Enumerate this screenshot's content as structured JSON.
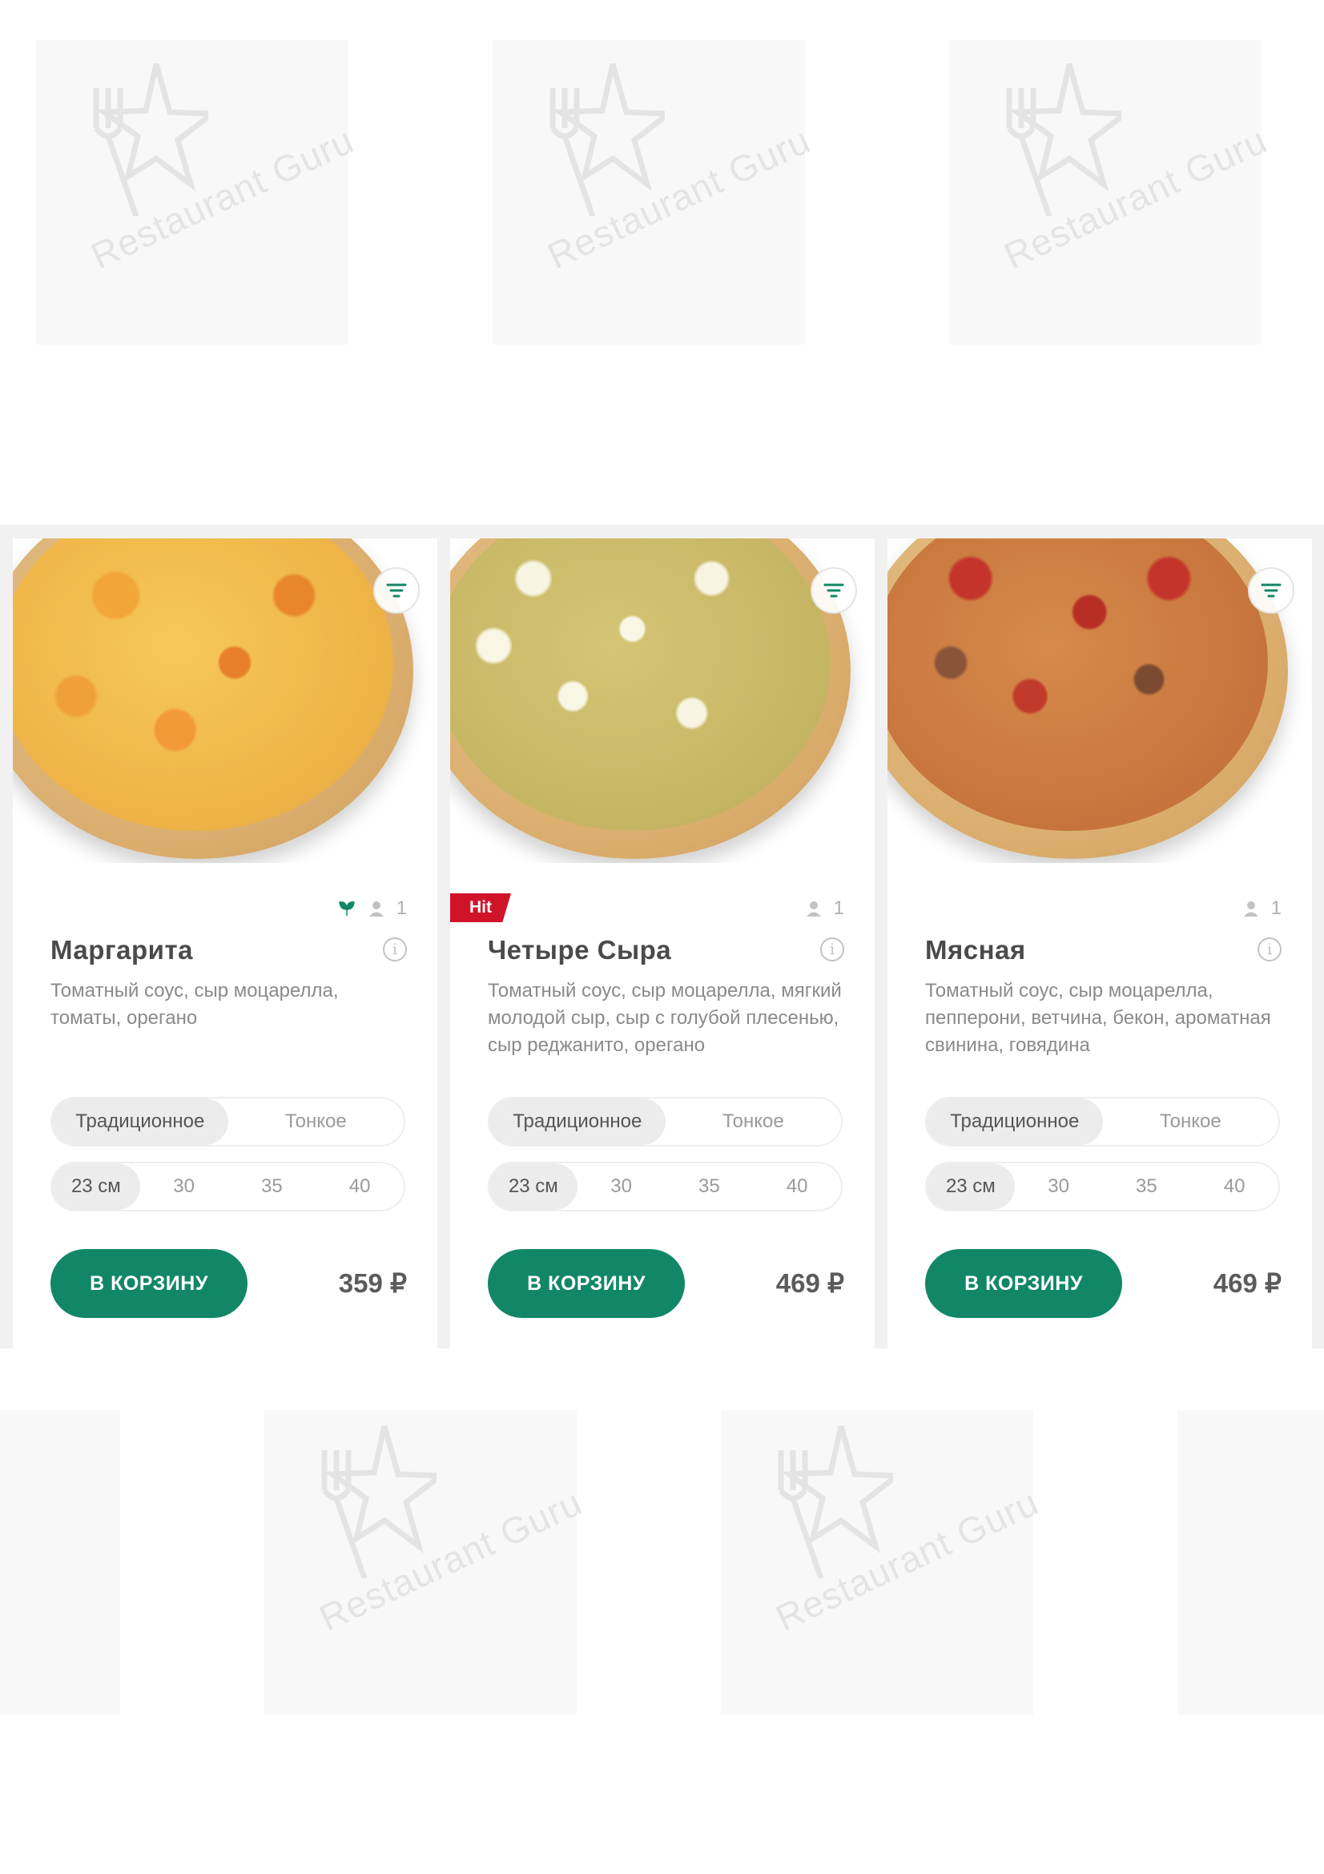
{
  "watermark": {
    "text": "Restaurant Guru",
    "color": "#e4e4e4"
  },
  "colors": {
    "accent": "#128767",
    "hit_badge": "#d1132a",
    "strip_bg": "#f1f1f1"
  },
  "products": [
    {
      "name": "Маргарита",
      "description": "Томатный соус, сыр моцарелла, томаты, орегано",
      "badge": "",
      "vegetarian": true,
      "persons": "1",
      "dough_options": [
        "Традиционное",
        "Тонкое"
      ],
      "dough_selected": "Традиционное",
      "sizes": [
        "23 см",
        "30",
        "35",
        "40"
      ],
      "size_selected": "23 см",
      "button": "В КОРЗИНУ",
      "price": "359 ₽",
      "icon_filter": "filter-icon",
      "icon_info": "info-icon"
    },
    {
      "name": "Четыре Сыра",
      "description": "Томатный соус, сыр моцарелла, мягкий молодой сыр, сыр с голубой плесенью, сыр реджанито, орегано",
      "badge": "Hit",
      "vegetarian": false,
      "persons": "1",
      "dough_options": [
        "Традиционное",
        "Тонкое"
      ],
      "dough_selected": "Традиционное",
      "sizes": [
        "23 см",
        "30",
        "35",
        "40"
      ],
      "size_selected": "23 см",
      "button": "В КОРЗИНУ",
      "price": "469 ₽",
      "icon_filter": "filter-icon",
      "icon_info": "info-icon"
    },
    {
      "name": "Мясная",
      "description": "Томатный соус, сыр моцарелла, пепперони, ветчина, бекон, ароматная свинина, говядина",
      "badge": "",
      "vegetarian": false,
      "persons": "1",
      "dough_options": [
        "Традиционное",
        "Тонкое"
      ],
      "dough_selected": "Традиционное",
      "sizes": [
        "23 см",
        "30",
        "35",
        "40"
      ],
      "size_selected": "23 см",
      "button": "В КОРЗИНУ",
      "price": "469 ₽",
      "icon_filter": "filter-icon",
      "icon_info": "info-icon"
    }
  ]
}
